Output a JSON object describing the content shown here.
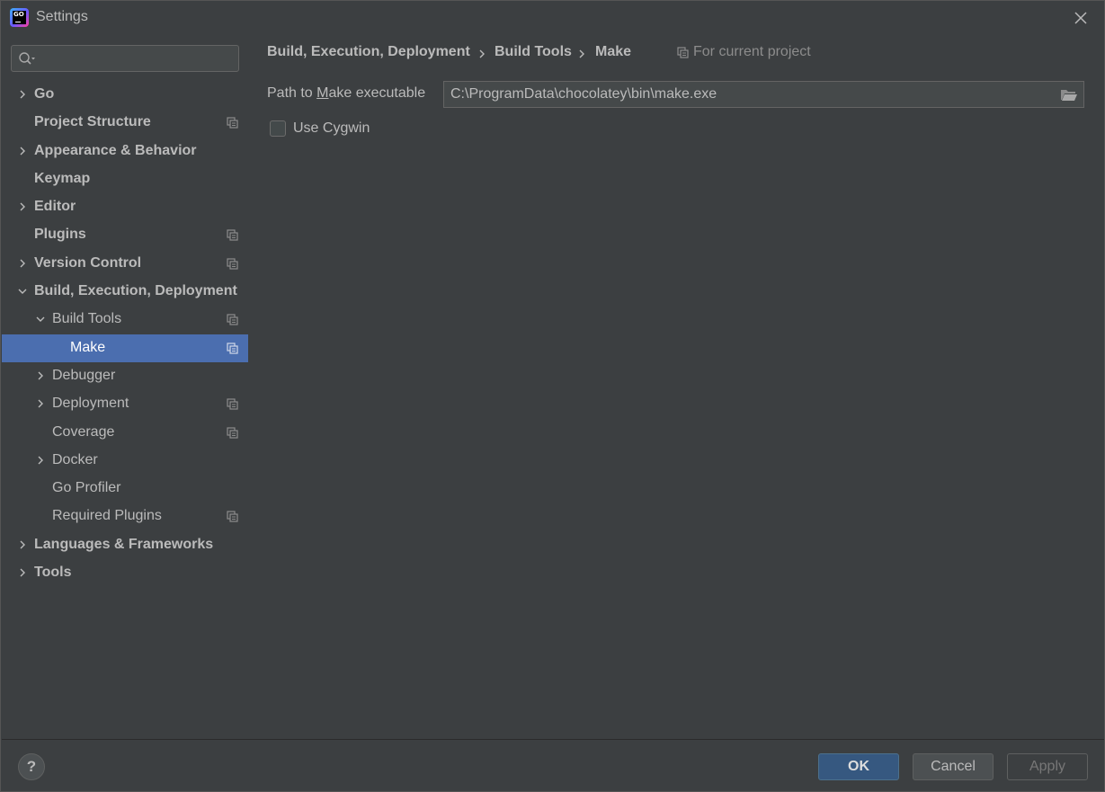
{
  "window": {
    "title": "Settings"
  },
  "search": {
    "value": "",
    "placeholder": ""
  },
  "sidebar": {
    "items": [
      {
        "label": "Go",
        "level": 0,
        "bold": true,
        "chevron": "right",
        "project": false
      },
      {
        "label": "Project Structure",
        "level": 0,
        "bold": true,
        "chevron": "none",
        "project": true
      },
      {
        "label": "Appearance & Behavior",
        "level": 0,
        "bold": true,
        "chevron": "right",
        "project": false
      },
      {
        "label": "Keymap",
        "level": 0,
        "bold": true,
        "chevron": "none",
        "project": false
      },
      {
        "label": "Editor",
        "level": 0,
        "bold": true,
        "chevron": "right",
        "project": false
      },
      {
        "label": "Plugins",
        "level": 0,
        "bold": true,
        "chevron": "none",
        "project": true
      },
      {
        "label": "Version Control",
        "level": 0,
        "bold": true,
        "chevron": "right",
        "project": true
      },
      {
        "label": "Build, Execution, Deployment",
        "level": 0,
        "bold": true,
        "chevron": "down",
        "project": false
      },
      {
        "label": "Build Tools",
        "level": 1,
        "bold": false,
        "chevron": "down",
        "project": true
      },
      {
        "label": "Make",
        "level": 2,
        "bold": false,
        "chevron": "none",
        "project": true,
        "selected": true
      },
      {
        "label": "Debugger",
        "level": 1,
        "bold": false,
        "chevron": "right",
        "project": false
      },
      {
        "label": "Deployment",
        "level": 1,
        "bold": false,
        "chevron": "right",
        "project": true
      },
      {
        "label": "Coverage",
        "level": 1,
        "bold": false,
        "chevron": "none",
        "project": true
      },
      {
        "label": "Docker",
        "level": 1,
        "bold": false,
        "chevron": "right",
        "project": false
      },
      {
        "label": "Go Profiler",
        "level": 1,
        "bold": false,
        "chevron": "none",
        "project": false
      },
      {
        "label": "Required Plugins",
        "level": 1,
        "bold": false,
        "chevron": "none",
        "project": true
      },
      {
        "label": "Languages & Frameworks",
        "level": 0,
        "bold": true,
        "chevron": "right",
        "project": false
      },
      {
        "label": "Tools",
        "level": 0,
        "bold": true,
        "chevron": "right",
        "project": false
      }
    ]
  },
  "breadcrumb": {
    "items": [
      "Build, Execution, Deployment",
      "Build Tools",
      "Make"
    ],
    "scope": "For current project"
  },
  "make": {
    "path_label_pre": "Path to ",
    "path_label_mnemonic": "M",
    "path_label_post": "ake executable",
    "path_value": "C:\\ProgramData\\chocolatey\\bin\\make.exe",
    "use_cygwin_label": "Use Cygwin",
    "use_cygwin_checked": false
  },
  "footer": {
    "help_label": "?",
    "ok_label": "OK",
    "cancel_label": "Cancel",
    "apply_label": "Apply"
  },
  "colors": {
    "background": "#3c3f41",
    "selection": "#4b6eaf",
    "ok_button": "#365880",
    "text": "#bbbbbb"
  }
}
